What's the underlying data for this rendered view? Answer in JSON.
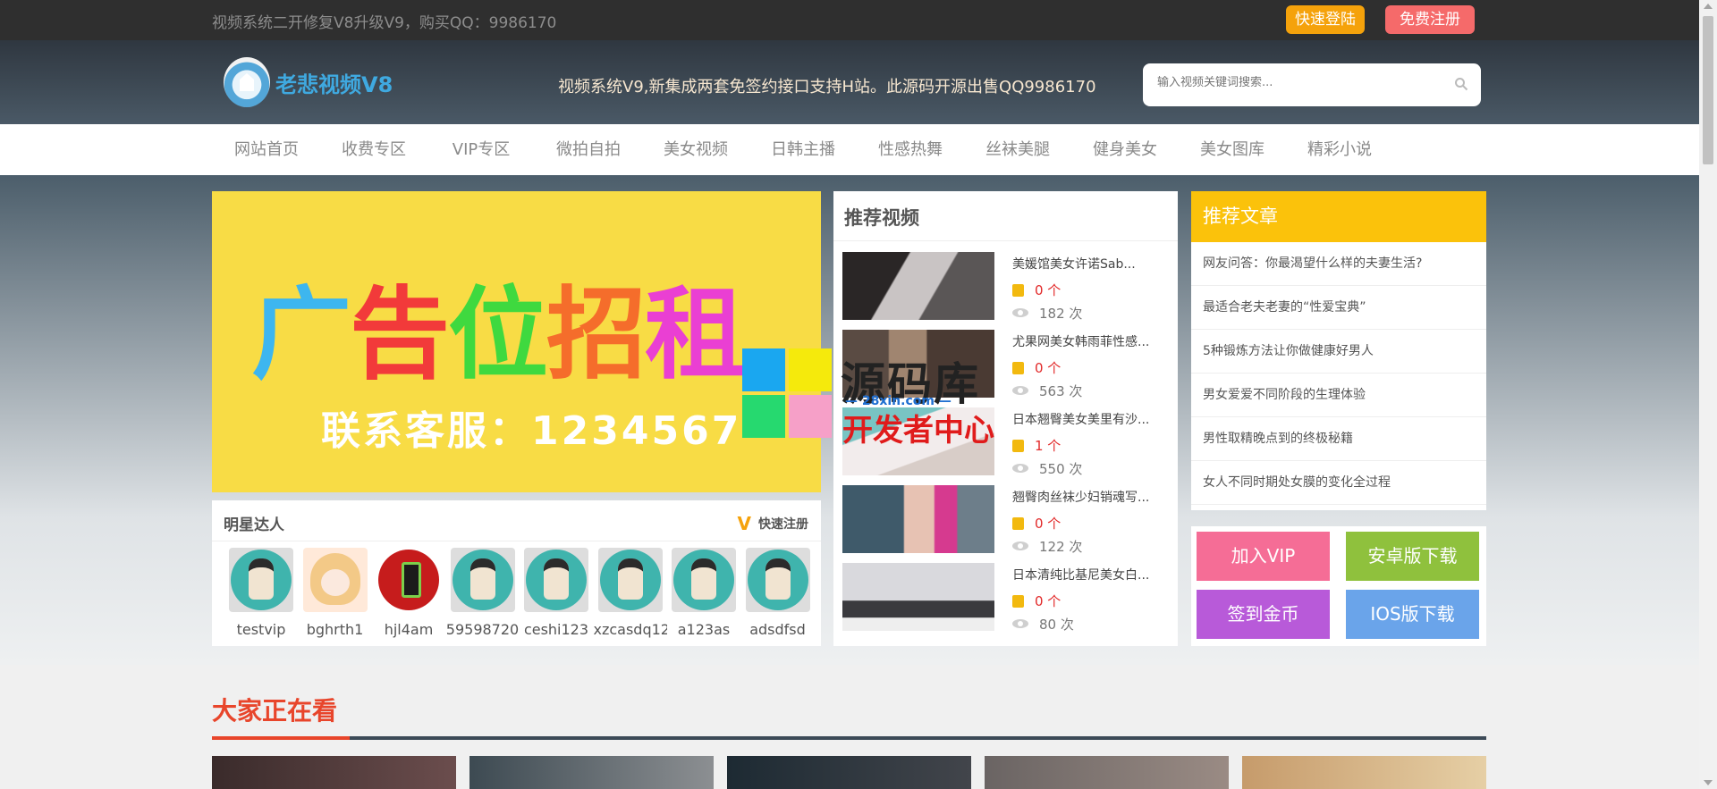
{
  "topbar": {
    "notice": "视频系统二开修复V8升级V9，购买QQ：9986170",
    "login_label": "快速登陆",
    "register_label": "免费注册"
  },
  "header": {
    "logo_text": "老悲视频V8",
    "slogan": "视频系统V9,新集成两套免签约接口支持H站。此源码开源出售QQ9986170",
    "search_placeholder": "输入视频关键词搜索..."
  },
  "nav": {
    "items": [
      "网站首页",
      "收费专区",
      "VIP专区",
      "微拍自拍",
      "美女视频",
      "日韩主播",
      "性感热舞",
      "丝袜美腿",
      "健身美女",
      "美女图库",
      "精彩小说"
    ]
  },
  "ad": {
    "title_chars": [
      "广",
      "告",
      "位",
      "招",
      "租"
    ],
    "contact": "联系客服：1234567"
  },
  "watermark": {
    "line1": "源码库",
    "line2": "— 28xin.com —",
    "line3": "开发者中心"
  },
  "stars": {
    "title": "明星达人",
    "quick_register": "快速注册",
    "users": [
      "testvip",
      "bghrth1",
      "hjl4am",
      "59598720",
      "ceshi123",
      "xzcasdq12",
      "a123as",
      "adsdfsd"
    ]
  },
  "recommended_videos": {
    "title": "推荐视频",
    "items": [
      {
        "title": "美媛馆美女许诺Sab...",
        "count": "0 个",
        "views": "182 次"
      },
      {
        "title": "尤果网美女韩雨菲性感...",
        "count": "0 个",
        "views": "563 次"
      },
      {
        "title": "日本翘臀美女美里有沙...",
        "count": "1 个",
        "views": "550 次"
      },
      {
        "title": "翘臀肉丝袜少妇销魂写...",
        "count": "0 个",
        "views": "122 次"
      },
      {
        "title": "日本清纯比基尼美女白...",
        "count": "0 个",
        "views": "80 次"
      }
    ]
  },
  "recommended_articles": {
    "title": "推荐文章",
    "items": [
      "网友问答：你最渴望什么样的夫妻生活?",
      "最适合老夫老妻的“性爱宝典”",
      "5种锻炼方法让你做健康好男人",
      "男女爱爱不同阶段的生理体验",
      "男性取精晚点到的终极秘籍",
      "女人不同时期处女膜的变化全过程"
    ]
  },
  "actions": {
    "join_vip": "加入VIP",
    "android_download": "安卓版下载",
    "sign_in": "签到金币",
    "ios_download": "IOS版下载"
  },
  "colors": {
    "accent_orange": "#f5a20b",
    "accent_red": "#f56a6a",
    "article_header": "#fbc20b",
    "vip_pink": "#f56d96",
    "android_green": "#8fc13d",
    "signin_purple": "#b85ad9",
    "ios_blue": "#6aa4ea",
    "section_red": "#e8452b"
  },
  "hot_section": {
    "title": "大家正在看"
  }
}
